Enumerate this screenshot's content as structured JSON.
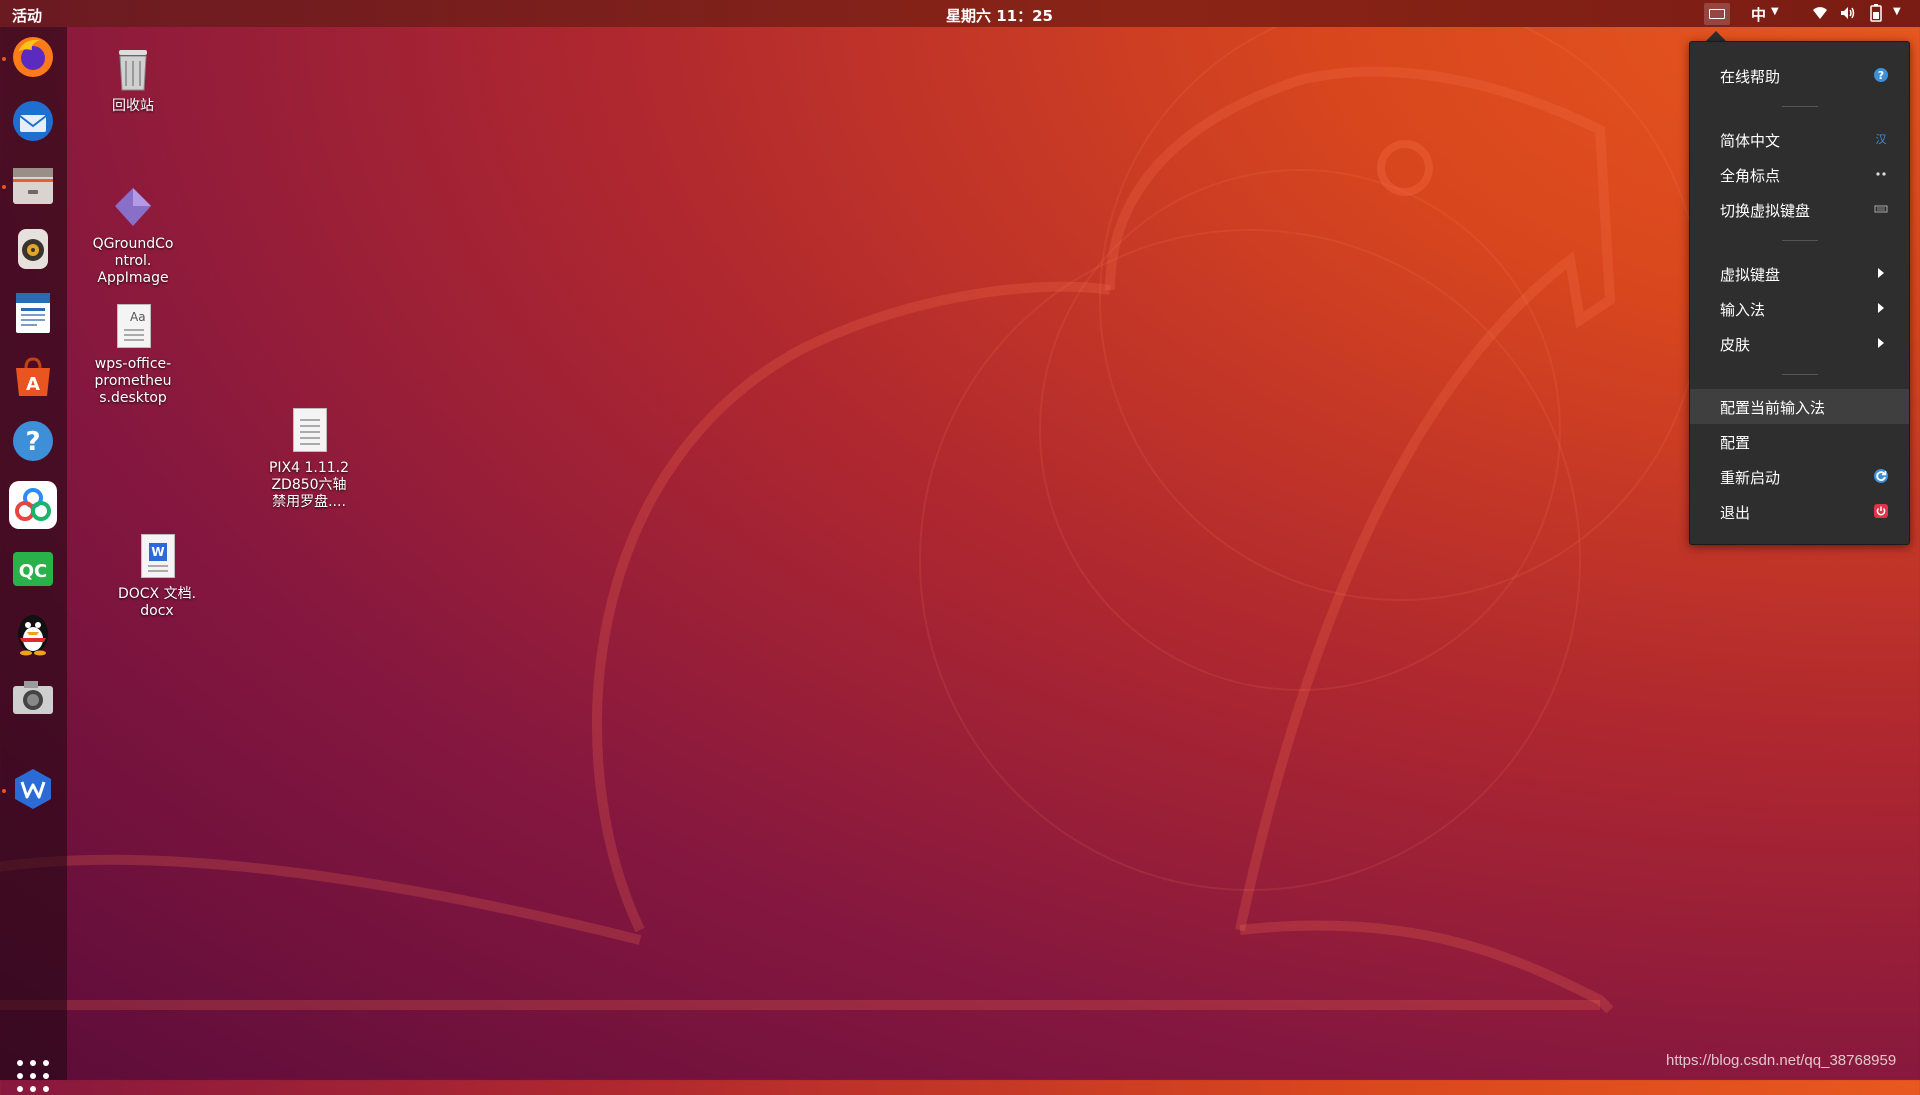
{
  "topbar": {
    "activities": "活动",
    "clock": "星期六 11：25",
    "ime_indicator": "中",
    "tray_icons": [
      "keyboard-icon",
      "wifi-icon",
      "volume-icon",
      "battery-icon"
    ]
  },
  "dock": {
    "items": [
      {
        "name": "firefox-icon",
        "running": true
      },
      {
        "name": "thunderbird-icon",
        "running": false
      },
      {
        "name": "files-icon",
        "running": true
      },
      {
        "name": "rhythmbox-icon",
        "running": false
      },
      {
        "name": "writer-icon",
        "running": false
      },
      {
        "name": "software-center-icon",
        "running": false
      },
      {
        "name": "help-icon",
        "running": false
      },
      {
        "name": "baidu-netdisk-icon",
        "running": false
      },
      {
        "name": "qgroundcontrol-icon",
        "running": false
      },
      {
        "name": "qq-icon",
        "running": false
      },
      {
        "name": "camera-icon",
        "running": false
      },
      {
        "name": "wps-icon",
        "running": true
      }
    ],
    "show_apps": "apps-grid-icon"
  },
  "desktop": {
    "icons": [
      {
        "label": "回收站"
      },
      {
        "label": "QGroundControl.AppImage",
        "lines": [
          "QGroundCo",
          "ntrol.",
          "AppImage"
        ]
      },
      {
        "label": "wps-office-prometheus.desktop",
        "lines": [
          "wps-office-",
          "prometheu",
          "s.desktop"
        ]
      },
      {
        "label": "PIX4 1.11.2 ZD850六轴禁用罗盘....",
        "lines": [
          "PIX4 1.11.2",
          "ZD850六轴",
          "禁用罗盘...."
        ]
      },
      {
        "label": "DOCX 文档.docx",
        "lines": [
          "DOCX 文档.",
          "docx"
        ]
      }
    ]
  },
  "menu": {
    "online_help": "在线帮助",
    "simplified_chinese": "简体中文",
    "fullwidth_punct": "全角标点",
    "toggle_virtual_keyboard": "切换虚拟键盘",
    "virtual_keyboard": "虚拟键盘",
    "input_method": "输入法",
    "skin": "皮肤",
    "configure_current_im": "配置当前输入法",
    "configure": "配置",
    "restart": "重新启动",
    "exit": "退出"
  },
  "watermark": "https://blog.csdn.net/qq_38768959",
  "colors": {
    "accent": "#e95420",
    "menu_bg": "#2e2e2e",
    "help_blue": "#3d8fd8",
    "exit_red": "#e0334a"
  }
}
